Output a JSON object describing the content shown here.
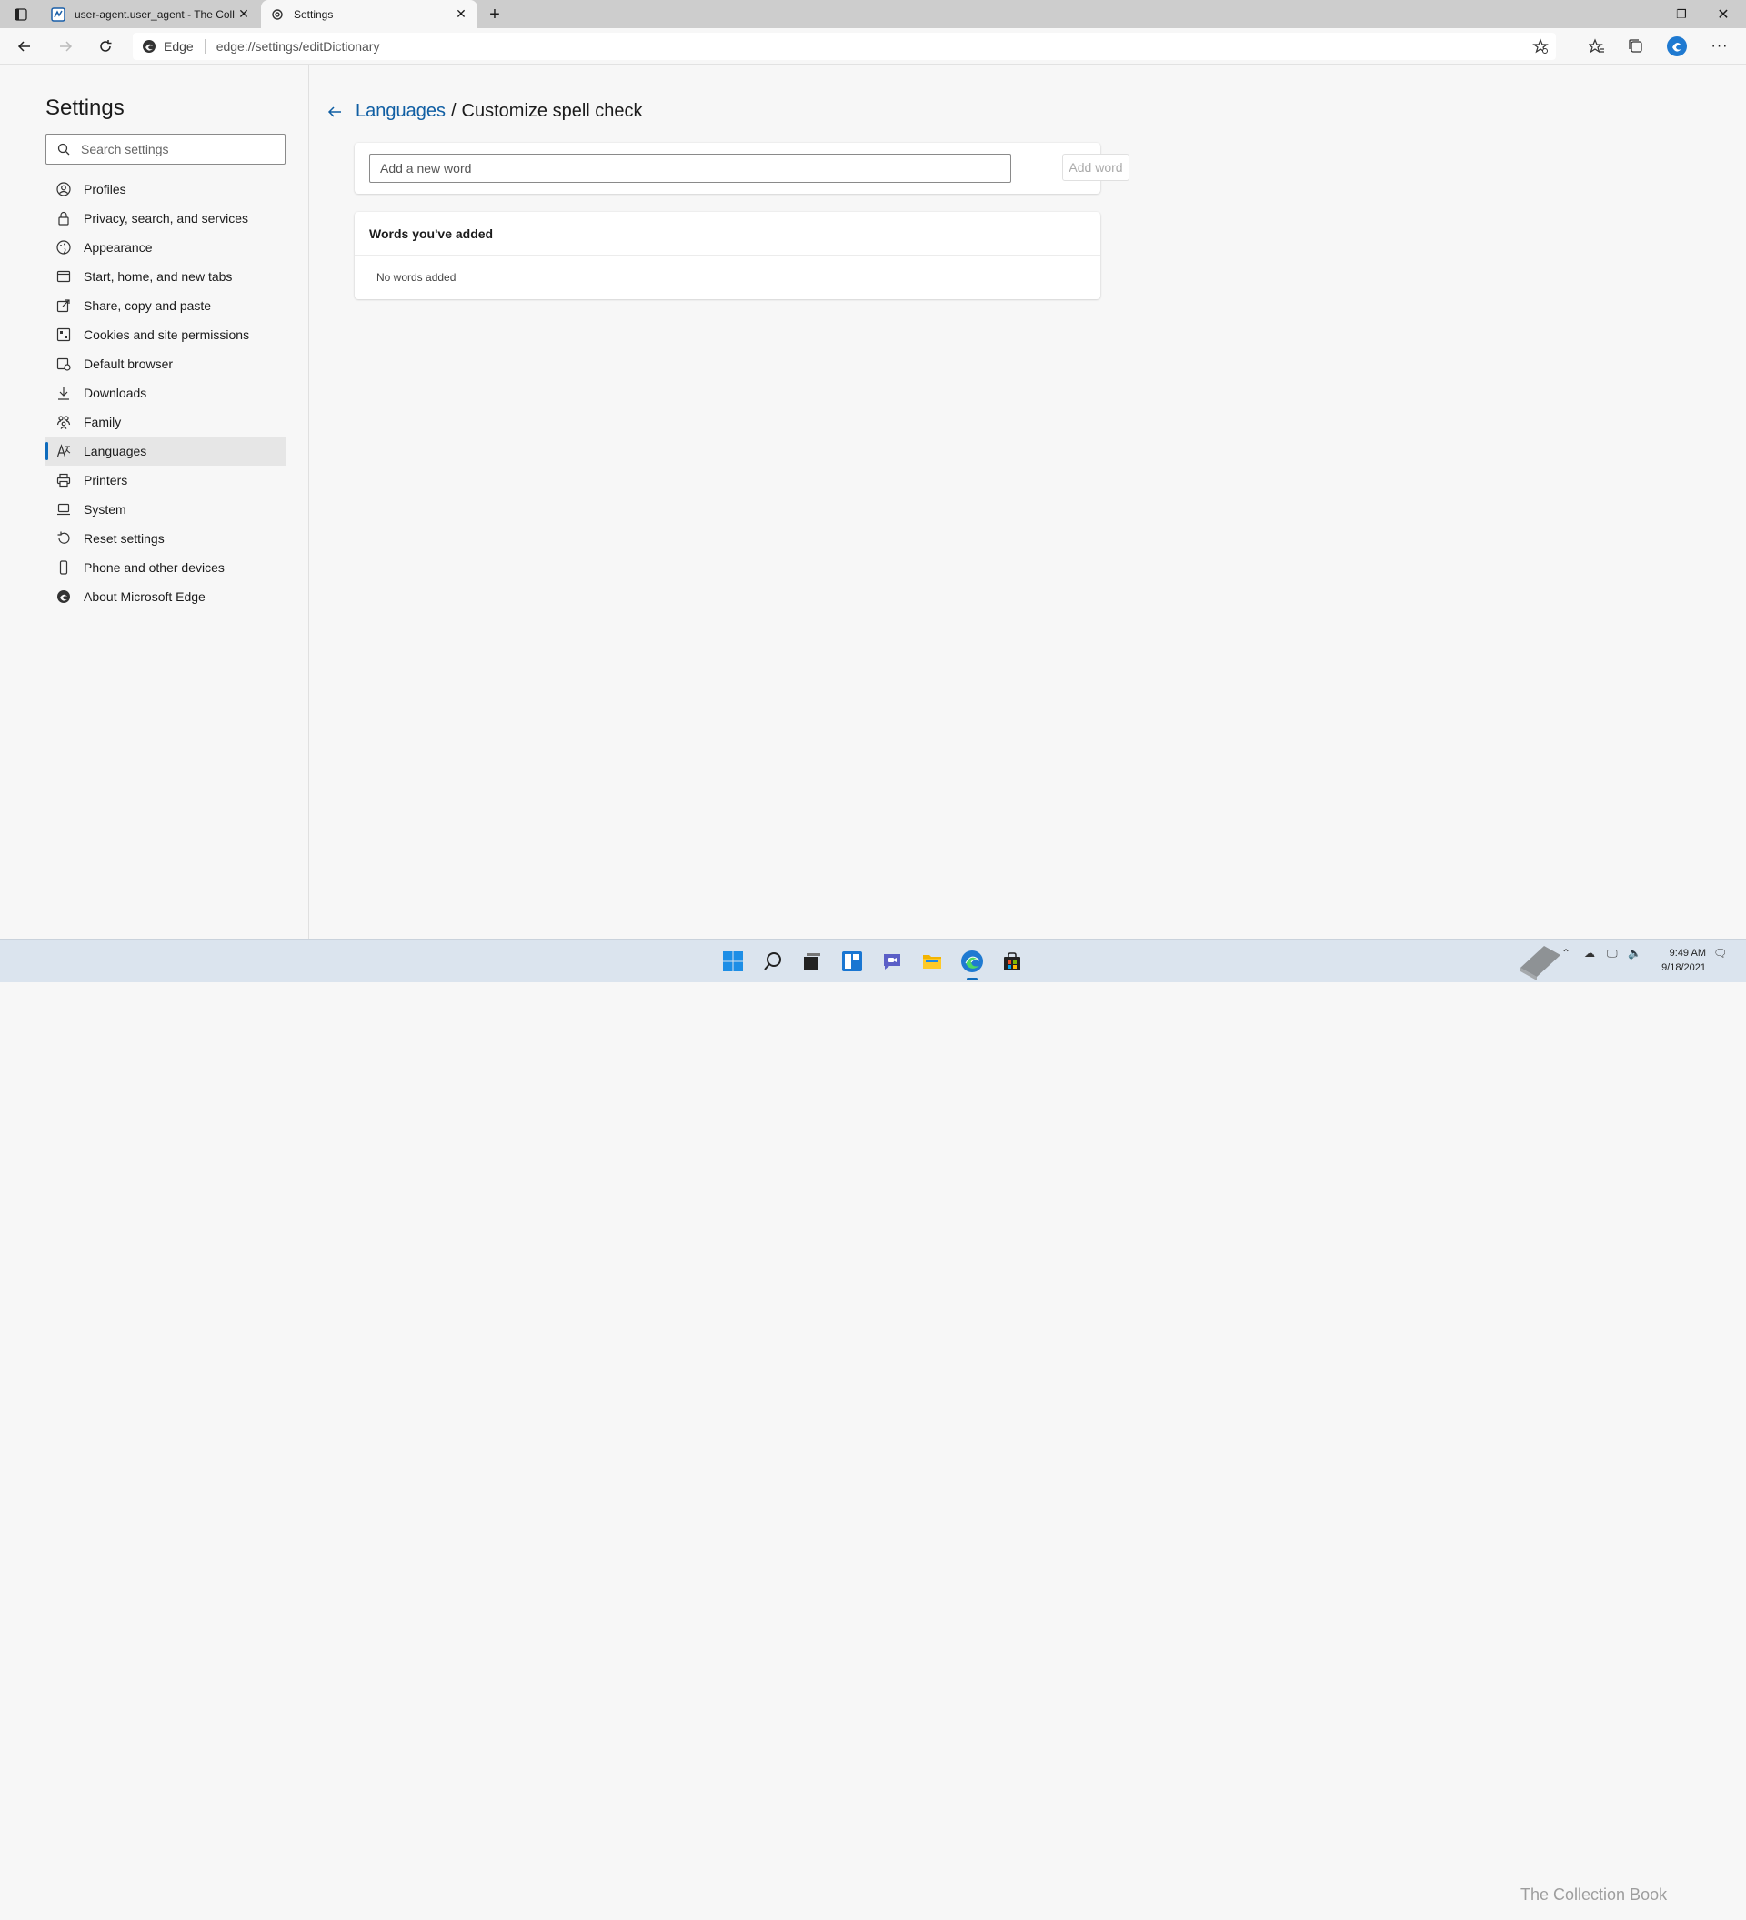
{
  "browser": {
    "tabs": [
      {
        "title": "user-agent.user_agent - The Coll",
        "active": false
      },
      {
        "title": "Settings",
        "active": true
      }
    ],
    "address": {
      "site_label": "Edge",
      "url": "edge://settings/editDictionary"
    }
  },
  "sidebar": {
    "title": "Settings",
    "search_placeholder": "Search settings",
    "items": [
      {
        "label": "Profiles",
        "icon": "profile-icon"
      },
      {
        "label": "Privacy, search, and services",
        "icon": "lock-icon"
      },
      {
        "label": "Appearance",
        "icon": "appearance-icon"
      },
      {
        "label": "Start, home, and new tabs",
        "icon": "home-tabs-icon"
      },
      {
        "label": "Share, copy and paste",
        "icon": "share-icon"
      },
      {
        "label": "Cookies and site permissions",
        "icon": "cookies-icon"
      },
      {
        "label": "Default browser",
        "icon": "default-browser-icon"
      },
      {
        "label": "Downloads",
        "icon": "download-icon"
      },
      {
        "label": "Family",
        "icon": "family-icon"
      },
      {
        "label": "Languages",
        "icon": "languages-icon",
        "selected": true
      },
      {
        "label": "Printers",
        "icon": "printer-icon"
      },
      {
        "label": "System",
        "icon": "system-icon"
      },
      {
        "label": "Reset settings",
        "icon": "reset-icon"
      },
      {
        "label": "Phone and other devices",
        "icon": "phone-icon"
      },
      {
        "label": "About Microsoft Edge",
        "icon": "edge-icon"
      }
    ]
  },
  "main": {
    "breadcrumb_parent": "Languages",
    "breadcrumb_sep": "/",
    "breadcrumb_current": "Customize spell check",
    "add_word_placeholder": "Add a new word",
    "add_word_button": "Add word",
    "words_header": "Words you've added",
    "words_empty": "No words added"
  },
  "taskbar": {
    "time": "9:49 AM",
    "date": "9/18/2021",
    "watermark": "The Collection Book"
  },
  "colors": {
    "accent": "#0f6cbd",
    "link": "#0f5ea3"
  }
}
